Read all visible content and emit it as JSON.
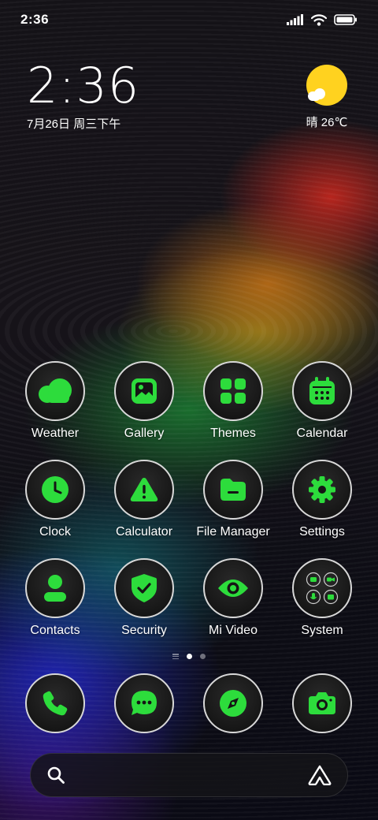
{
  "status_bar": {
    "time": "2:36",
    "icons": [
      "signal-icon",
      "wifi-icon",
      "battery-icon"
    ]
  },
  "clock_widget": {
    "time": "2:36",
    "date": "7月26日 周三下午"
  },
  "weather_widget": {
    "condition_icon": "sunny-cloud-icon",
    "text": "晴 26℃"
  },
  "apps": [
    {
      "label": "Weather",
      "icon": "weather-icon"
    },
    {
      "label": "Gallery",
      "icon": "gallery-icon"
    },
    {
      "label": "Themes",
      "icon": "themes-icon"
    },
    {
      "label": "Calendar",
      "icon": "calendar-icon"
    },
    {
      "label": "Clock",
      "icon": "clock-icon"
    },
    {
      "label": "Calculator",
      "icon": "calculator-icon"
    },
    {
      "label": "File Manager",
      "icon": "file-manager-icon"
    },
    {
      "label": "Settings",
      "icon": "settings-icon"
    },
    {
      "label": "Contacts",
      "icon": "contacts-icon"
    },
    {
      "label": "Security",
      "icon": "security-icon"
    },
    {
      "label": "Mi Video",
      "icon": "mi-video-icon"
    },
    {
      "label": "System",
      "icon": "system-folder-icon"
    }
  ],
  "page_indicator": {
    "pages": 2,
    "active_page": 1
  },
  "dock": [
    {
      "icon": "phone-icon"
    },
    {
      "icon": "messages-icon"
    },
    {
      "icon": "browser-icon"
    },
    {
      "icon": "camera-icon"
    }
  ],
  "search_bar": {
    "left_icon": "search-icon",
    "right_icon": "assistant-icon"
  },
  "colors": {
    "accent": "#2ddc3c",
    "icon_ring": "#d8d8d8",
    "icon_bg": "#151515"
  }
}
